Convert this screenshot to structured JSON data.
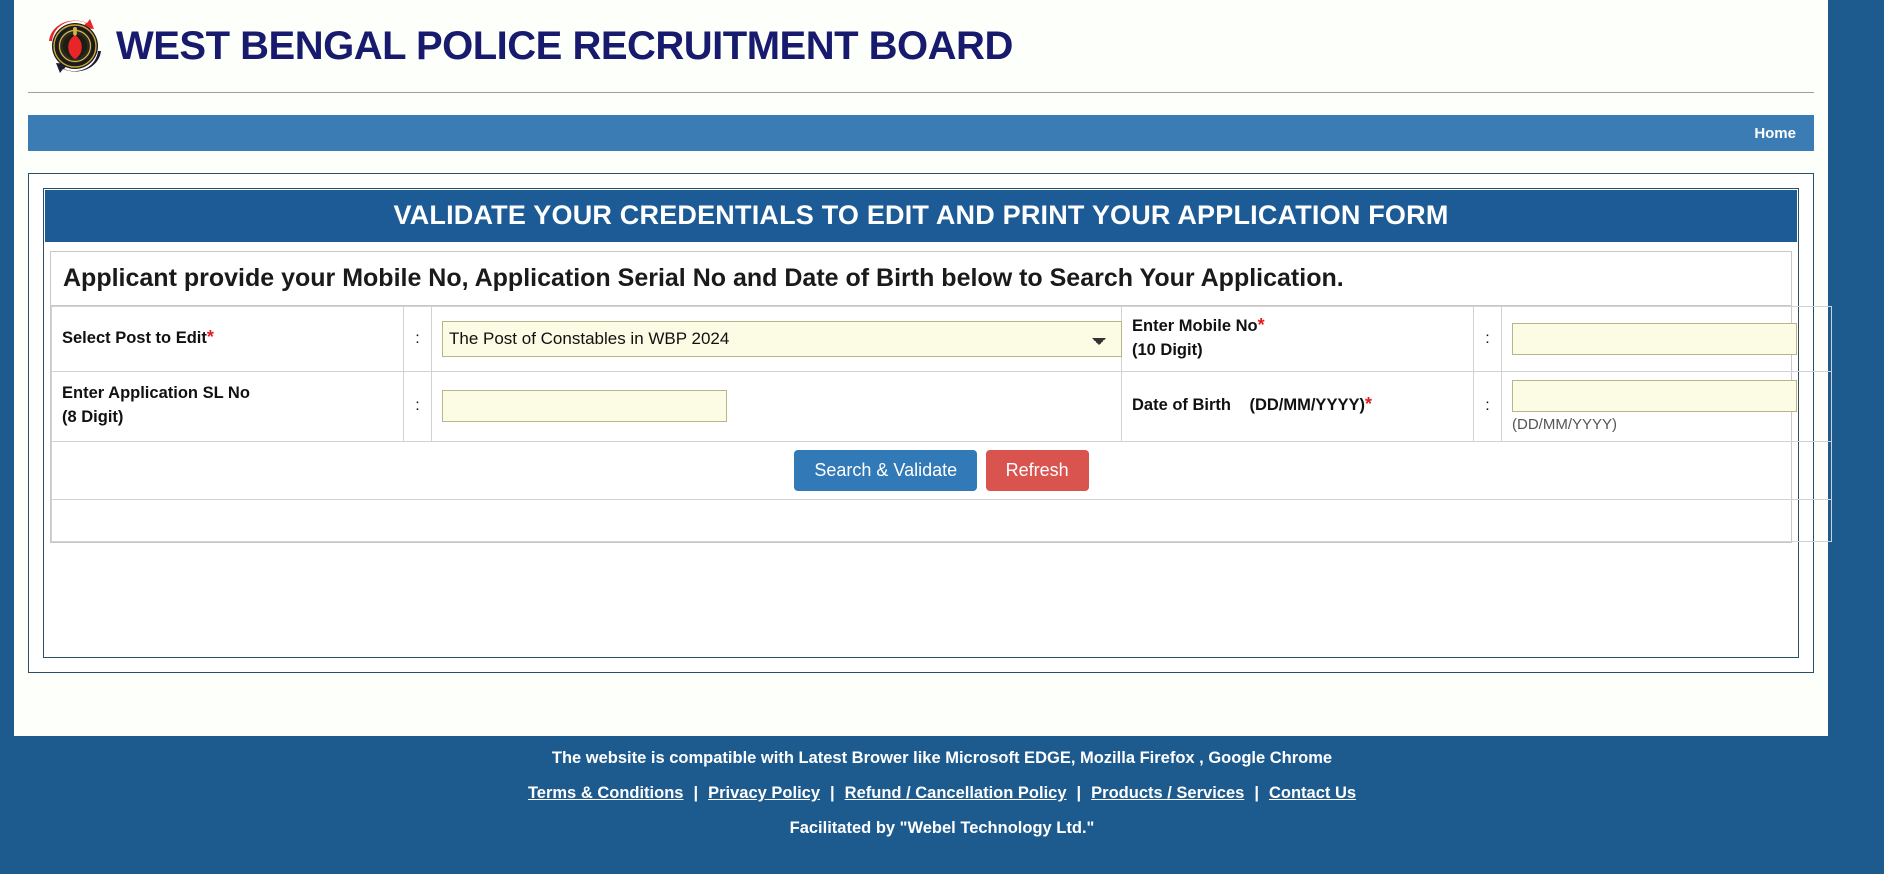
{
  "header": {
    "title": "WEST BENGAL POLICE RECRUITMENT BOARD",
    "logo_alt": "wbprb-emblem"
  },
  "nav": {
    "home_label": "Home"
  },
  "panel": {
    "title": "VALIDATE YOUR CREDENTIALS TO EDIT AND PRINT YOUR APPLICATION FORM",
    "instruction": "Applicant provide your Mobile No, Application Serial No and Date of Birth below to Search Your Application.",
    "colon": ":"
  },
  "form": {
    "post_label": "Select Post to Edit",
    "post_required": "*",
    "post_selected": "The Post of Constables in WBP 2024",
    "post_options": [
      "The Post of Constables in WBP 2024"
    ],
    "mobile_label": "Enter Mobile No",
    "mobile_required": "*",
    "mobile_sub": "(10 Digit)",
    "mobile_value": "",
    "mobile_placeholder": "",
    "sl_label": "Enter Application SL No",
    "sl_sub": "(8 Digit)",
    "sl_value": "",
    "sl_placeholder": "",
    "dob_label": "Date of Birth",
    "dob_format": "(DD/MM/YYYY)",
    "dob_required": "*",
    "dob_value": "",
    "dob_placeholder": "",
    "dob_hint": "(DD/MM/YYYY)",
    "search_button": "Search & Validate",
    "refresh_button": "Refresh"
  },
  "footer": {
    "compatibility": "The website is compatible with Latest Brower like Microsoft EDGE, Mozilla Firefox , Google Chrome",
    "links": [
      "Terms & Conditions",
      "Privacy Policy",
      "Refund / Cancellation Policy",
      "Products / Services",
      "Contact Us"
    ],
    "separator": "|",
    "credit": "Facilitated by \"Webel Technology Ltd.\""
  },
  "colors": {
    "brand_blue": "#1d5b8f",
    "nav_blue": "#3b7cb5",
    "title_navy": "#181a6e",
    "primary_button": "#3279b7",
    "danger_button": "#d9534f",
    "field_bg": "#fcfbe3",
    "required_red": "#e01b1b"
  }
}
